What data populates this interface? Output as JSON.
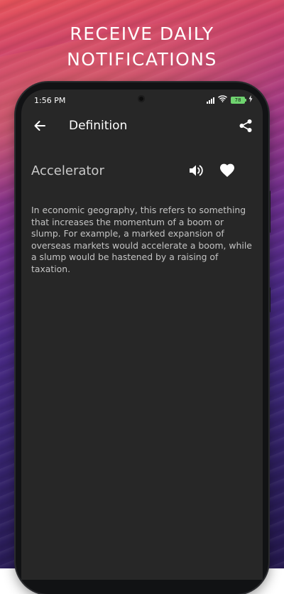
{
  "promo": {
    "headline_line1": "RECEIVE DAILY",
    "headline_line2": "NOTIFICATIONS"
  },
  "status_bar": {
    "time": "1:56 PM",
    "battery_level": "78"
  },
  "app_bar": {
    "title": "Definition",
    "back_icon": "arrow-left-icon",
    "share_icon": "share-icon"
  },
  "entry": {
    "word": "Accelerator",
    "speaker_icon": "speaker-icon",
    "favorite_icon": "heart-icon",
    "definition": "In economic geography, this refers to something that increases the momentum of a boom or slump. For example, a marked expansion of overseas markets would accelerate a boom, while a slump would be hastened by a raising of taxation."
  },
  "colors": {
    "screen_bg": "#272727",
    "text_primary": "#ffffff",
    "text_secondary": "#c4c4c4"
  }
}
